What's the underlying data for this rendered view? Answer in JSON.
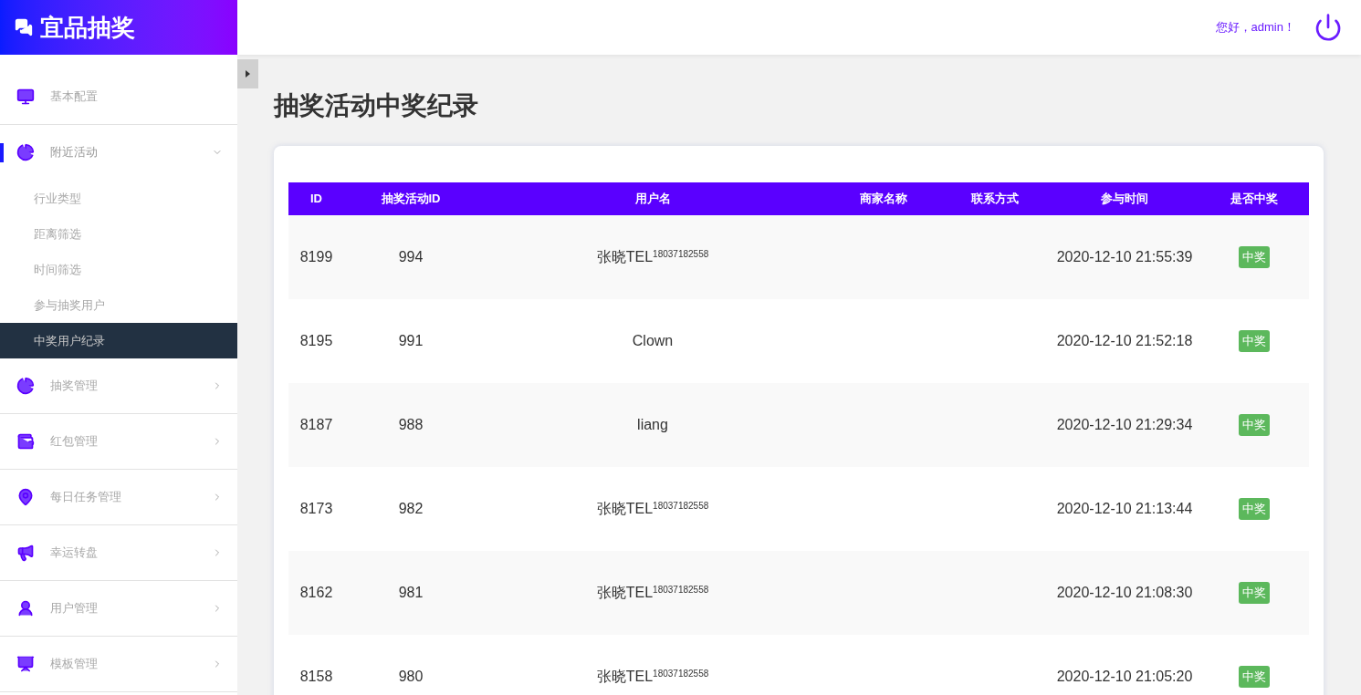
{
  "brand": {
    "title": "宜品抽奖"
  },
  "header": {
    "greeting": "您好，admin！"
  },
  "sidebar": {
    "items": [
      {
        "label": "基本配置",
        "kind": "monitor",
        "selected": false
      },
      {
        "label": "附近活动",
        "kind": "pie",
        "selected": true,
        "expanded": true,
        "children": [
          {
            "label": "行业类型",
            "selected": false
          },
          {
            "label": "距离筛选",
            "selected": false
          },
          {
            "label": "时间筛选",
            "selected": false
          },
          {
            "label": "参与抽奖用户",
            "selected": false
          },
          {
            "label": "中奖用户纪录",
            "selected": true
          }
        ]
      },
      {
        "label": "抽奖管理",
        "kind": "pie",
        "selected": false,
        "expanded": false
      },
      {
        "label": "红包管理",
        "kind": "wallet",
        "selected": false,
        "expanded": false
      },
      {
        "label": "每日任务管理",
        "kind": "pin",
        "selected": false,
        "expanded": false
      },
      {
        "label": "幸运转盘",
        "kind": "megaphone",
        "selected": false,
        "expanded": false
      },
      {
        "label": "用户管理",
        "kind": "user",
        "selected": false,
        "expanded": false
      },
      {
        "label": "模板管理",
        "kind": "board",
        "selected": false,
        "expanded": false
      }
    ]
  },
  "page": {
    "title": "抽奖活动中奖纪录"
  },
  "table": {
    "columns": [
      "ID",
      "抽奖活动ID",
      "用户名",
      "商家名称",
      "联系方式",
      "参与时间",
      "是否中奖"
    ],
    "rows": [
      {
        "id": "8199",
        "activity_id": "994",
        "username": "张晓TEL$^{18037182558}$",
        "time": "2020-12-10 21:55:39",
        "status": "中奖"
      },
      {
        "id": "8195",
        "activity_id": "991",
        "username": "Clown",
        "time": "2020-12-10 21:52:18",
        "status": "中奖"
      },
      {
        "id": "8187",
        "activity_id": "988",
        "username": "liang",
        "time": "2020-12-10 21:29:34",
        "status": "中奖"
      },
      {
        "id": "8173",
        "activity_id": "982",
        "username": "张晓TEL$^{18037182558}$",
        "time": "2020-12-10 21:13:44",
        "status": "中奖"
      },
      {
        "id": "8162",
        "activity_id": "981",
        "username": "张晓TEL$^{18037182558}$",
        "time": "2020-12-10 21:08:30",
        "status": "中奖"
      },
      {
        "id": "8158",
        "activity_id": "980",
        "username": "张晓TEL$^{18037182558}$",
        "time": "2020-12-10 21:05:20",
        "status": "中奖"
      }
    ]
  }
}
